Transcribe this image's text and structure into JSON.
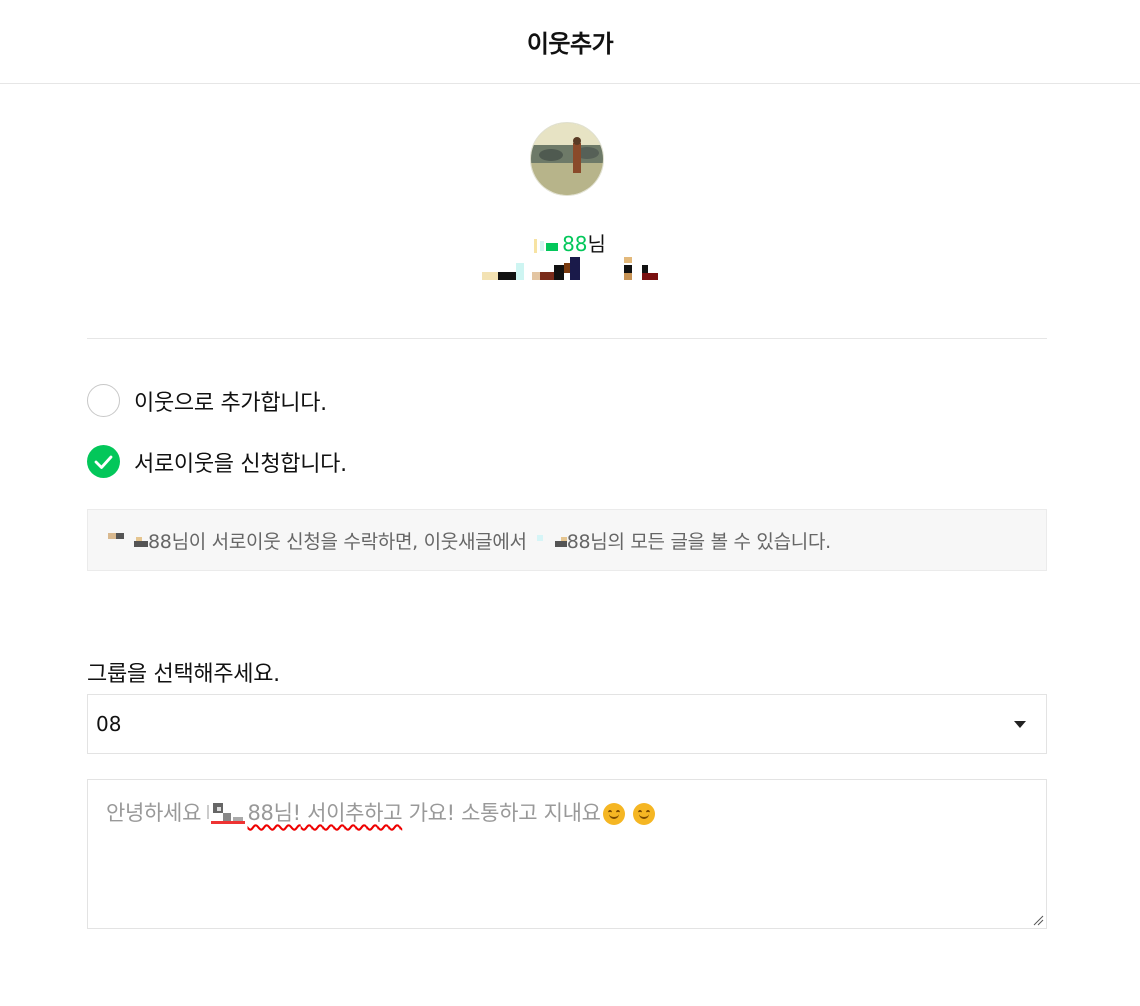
{
  "header": {
    "title": "이웃추가"
  },
  "profile": {
    "nickname_suffix": "88",
    "honorific": "님"
  },
  "options": [
    {
      "label": "이웃으로 추가합니다.",
      "checked": false
    },
    {
      "label": "서로이웃을 신청합니다.",
      "checked": true
    }
  ],
  "info": {
    "part1": "88님이 서로이웃 신청을 수락하면, 이웃새글에서 ",
    "part2": "88님의 모든 글을 볼 수 있습니다."
  },
  "group": {
    "label": "그룹을 선택해주세요.",
    "selected": "08"
  },
  "message": {
    "prefix": "안녕하세요 ",
    "nick": "88님!",
    "mid": " 서이추하고",
    "suffix": " 가요! 소통하고 지내요"
  },
  "colors": {
    "accent": "#03c75a"
  }
}
